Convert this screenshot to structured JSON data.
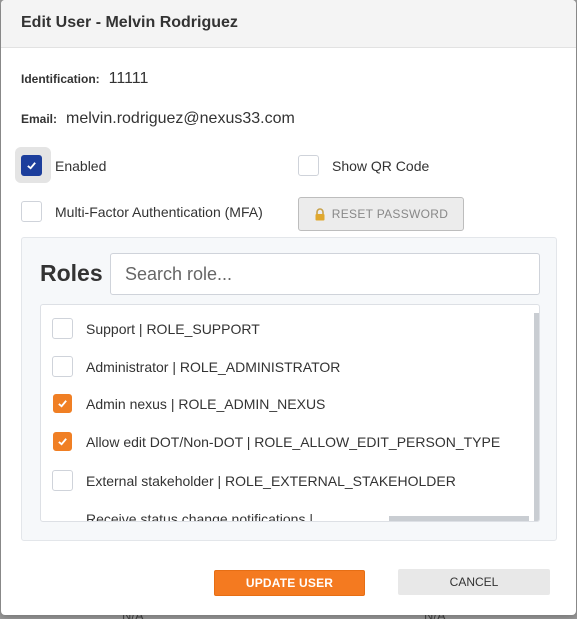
{
  "background": {
    "left_text": "N/A",
    "right_text": "N/A"
  },
  "modal": {
    "title": "Edit User - Melvin Rodriguez"
  },
  "fields": {
    "identification_label": "Identification:",
    "identification_value": "11111",
    "email_label": "Email:",
    "email_value": "melvin.rodriguez@nexus33.com"
  },
  "options": {
    "enabled_label": "Enabled",
    "enabled_checked": true,
    "show_qr_label": "Show QR Code",
    "show_qr_checked": false,
    "mfa_label": "Multi-Factor Authentication (MFA)",
    "mfa_checked": false,
    "reset_password_label": "RESET PASSWORD"
  },
  "roles": {
    "title": "Roles",
    "search_placeholder": "Search role...",
    "items": [
      {
        "label": "Support | ROLE_SUPPORT",
        "checked": false
      },
      {
        "label": "Administrator | ROLE_ADMINISTRATOR",
        "checked": false
      },
      {
        "label": "Admin nexus | ROLE_ADMIN_NEXUS",
        "checked": true
      },
      {
        "label": "Allow edit DOT/Non-DOT | ROLE_ALLOW_EDIT_PERSON_TYPE",
        "checked": true
      },
      {
        "label": "External stakeholder | ROLE_EXTERNAL_STAKEHOLDER",
        "checked": false
      }
    ],
    "partial_item_label": "Receive status change notifications |"
  },
  "actions": {
    "update_label": "UPDATE USER",
    "cancel_label": "CANCEL"
  },
  "colors": {
    "primary_blue": "#1c3e9c",
    "accent_orange": "#f47a20"
  }
}
